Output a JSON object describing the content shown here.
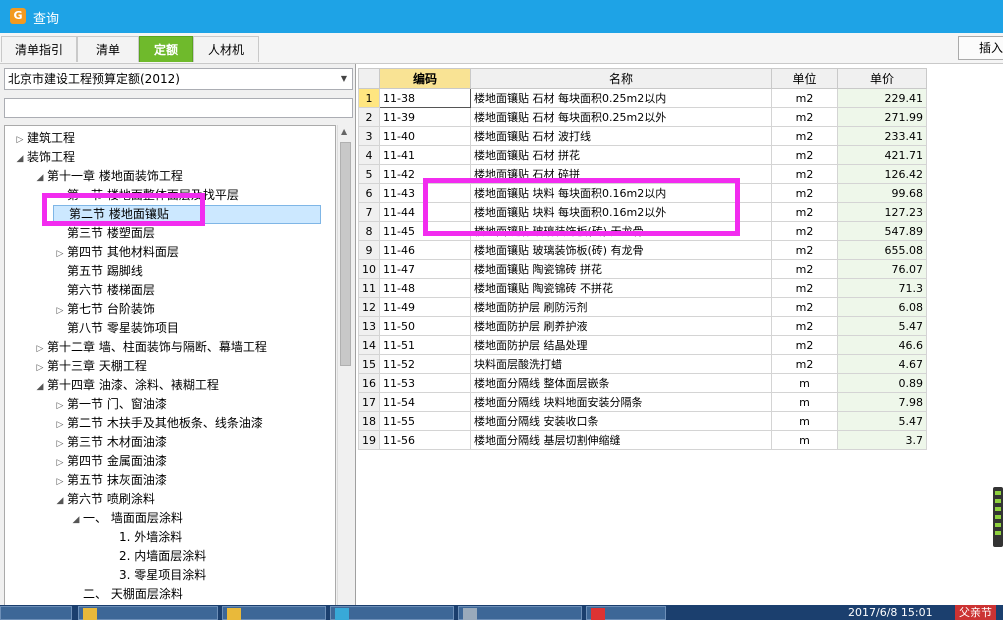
{
  "window": {
    "title": "查询"
  },
  "tabs": [
    {
      "label": "清单指引",
      "active": false
    },
    {
      "label": "清单",
      "active": false
    },
    {
      "label": "定额",
      "active": true
    },
    {
      "label": "人材机",
      "active": false
    }
  ],
  "toolbar": {
    "insert_label": "插入"
  },
  "quota_library": {
    "selected": "北京市建设工程预算定额(2012)",
    "filter_value": ""
  },
  "tree": [
    {
      "label": "建筑工程",
      "level": 0,
      "toggle": "collapsed"
    },
    {
      "label": "装饰工程",
      "level": 0,
      "toggle": "expanded"
    },
    {
      "label": "第十一章 楼地面装饰工程",
      "level": 1,
      "toggle": "expanded"
    },
    {
      "label": "第一节 楼地面整体面层及找平层",
      "level": 2,
      "toggle": "none"
    },
    {
      "label": "第二节 楼地面镶贴",
      "level": 2,
      "toggle": "none",
      "selected": true
    },
    {
      "label": "第三节 楼塑面层",
      "level": 2,
      "toggle": "none"
    },
    {
      "label": "第四节 其他材料面层",
      "level": 2,
      "toggle": "collapsed"
    },
    {
      "label": "第五节 踢脚线",
      "level": 2,
      "toggle": "none"
    },
    {
      "label": "第六节 楼梯面层",
      "level": 2,
      "toggle": "none"
    },
    {
      "label": "第七节 台阶装饰",
      "level": 2,
      "toggle": "collapsed"
    },
    {
      "label": "第八节 零星装饰项目",
      "level": 2,
      "toggle": "none"
    },
    {
      "label": "第十二章 墙、柱面装饰与隔断、幕墙工程",
      "level": 1,
      "toggle": "collapsed"
    },
    {
      "label": "第十三章 天棚工程",
      "level": 1,
      "toggle": "collapsed"
    },
    {
      "label": "第十四章 油漆、涂料、裱糊工程",
      "level": 1,
      "toggle": "expanded"
    },
    {
      "label": "第一节 门、窗油漆",
      "level": 2,
      "toggle": "collapsed"
    },
    {
      "label": "第二节 木扶手及其他板条、线条油漆",
      "level": 2,
      "toggle": "collapsed"
    },
    {
      "label": "第三节 木材面油漆",
      "level": 2,
      "toggle": "collapsed"
    },
    {
      "label": "第四节 金属面油漆",
      "level": 2,
      "toggle": "collapsed"
    },
    {
      "label": "第五节 抹灰面油漆",
      "level": 2,
      "toggle": "collapsed"
    },
    {
      "label": "第六节 喷刷涂料",
      "level": 2,
      "toggle": "expanded"
    },
    {
      "label": "一、 墙面面层涂料",
      "level": 3,
      "toggle": "expanded"
    },
    {
      "label": "1. 外墙涂料",
      "level": 4,
      "toggle": "none"
    },
    {
      "label": "2. 内墙面层涂料",
      "level": 4,
      "toggle": "none"
    },
    {
      "label": "3. 零星项目涂料",
      "level": 4,
      "toggle": "none"
    },
    {
      "label": "二、 天棚面层涂料",
      "level": 3,
      "toggle": "none"
    }
  ],
  "table": {
    "headers": {
      "code": "编码",
      "name": "名称",
      "unit": "单位",
      "price": "单价"
    },
    "rows": [
      {
        "no": "1",
        "code": "11-38",
        "name": "楼地面镶贴 石材 每块面积0.25m2以内",
        "unit": "m2",
        "price": "229.41"
      },
      {
        "no": "2",
        "code": "11-39",
        "name": "楼地面镶贴 石材 每块面积0.25m2以外",
        "unit": "m2",
        "price": "271.99"
      },
      {
        "no": "3",
        "code": "11-40",
        "name": "楼地面镶贴 石材 波打线",
        "unit": "m2",
        "price": "233.41"
      },
      {
        "no": "4",
        "code": "11-41",
        "name": "楼地面镶贴 石材 拼花",
        "unit": "m2",
        "price": "421.71"
      },
      {
        "no": "5",
        "code": "11-42",
        "name": "楼地面镶贴 石材 碎拼",
        "unit": "m2",
        "price": "126.42"
      },
      {
        "no": "6",
        "code": "11-43",
        "name": "楼地面镶贴 块料 每块面积0.16m2以内",
        "unit": "m2",
        "price": "99.68"
      },
      {
        "no": "7",
        "code": "11-44",
        "name": "楼地面镶贴 块料 每块面积0.16m2以外",
        "unit": "m2",
        "price": "127.23"
      },
      {
        "no": "8",
        "code": "11-45",
        "name": "楼地面镶贴 玻璃装饰板(砖) 无龙骨",
        "unit": "m2",
        "price": "547.89"
      },
      {
        "no": "9",
        "code": "11-46",
        "name": "楼地面镶贴 玻璃装饰板(砖) 有龙骨",
        "unit": "m2",
        "price": "655.08"
      },
      {
        "no": "10",
        "code": "11-47",
        "name": "楼地面镶贴 陶瓷锦砖 拼花",
        "unit": "m2",
        "price": "76.07"
      },
      {
        "no": "11",
        "code": "11-48",
        "name": "楼地面镶贴 陶瓷锦砖 不拼花",
        "unit": "m2",
        "price": "71.3"
      },
      {
        "no": "12",
        "code": "11-49",
        "name": "楼地面防护层 刷防污剂",
        "unit": "m2",
        "price": "6.08"
      },
      {
        "no": "13",
        "code": "11-50",
        "name": "楼地面防护层 刷养护液",
        "unit": "m2",
        "price": "5.47"
      },
      {
        "no": "14",
        "code": "11-51",
        "name": "楼地面防护层 结晶处理",
        "unit": "m2",
        "price": "46.6"
      },
      {
        "no": "15",
        "code": "11-52",
        "name": "块料面层酸洗打蜡",
        "unit": "m2",
        "price": "4.67"
      },
      {
        "no": "16",
        "code": "11-53",
        "name": "楼地面分隔线 整体面层嵌条",
        "unit": "m",
        "price": "0.89"
      },
      {
        "no": "17",
        "code": "11-54",
        "name": "楼地面分隔线 块料地面安装分隔条",
        "unit": "m",
        "price": "7.98"
      },
      {
        "no": "18",
        "code": "11-55",
        "name": "楼地面分隔线 安装收口条",
        "unit": "m",
        "price": "5.47"
      },
      {
        "no": "19",
        "code": "11-56",
        "name": "楼地面分隔线 基层切割伸缩缝",
        "unit": "m",
        "price": "3.7"
      }
    ]
  },
  "taskbar": {
    "clock": "2017/6/8 15:01",
    "ime": "父亲节"
  },
  "colors": {
    "titlebar": "#1ea3e6",
    "active_tab": "#6fba2c",
    "highlight_box": "#f22cef",
    "selection": "#cce8ff"
  }
}
